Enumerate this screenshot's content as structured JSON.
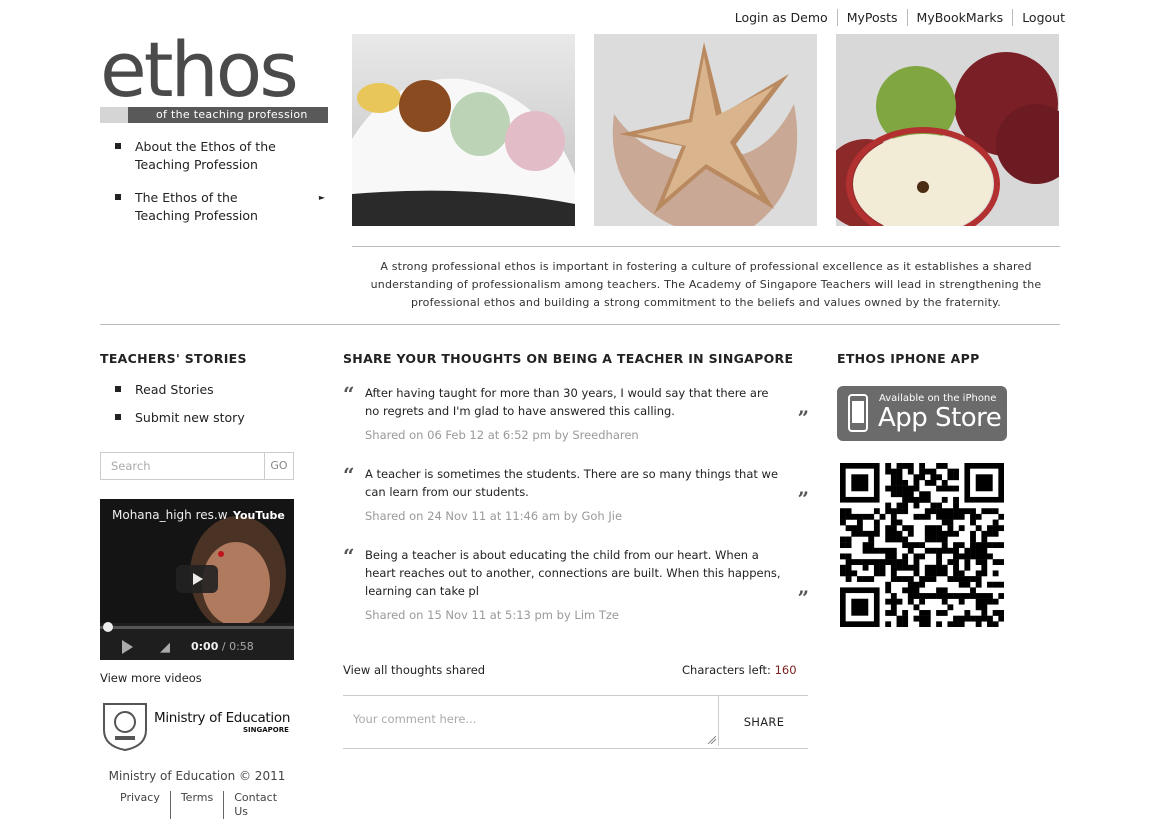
{
  "topnav": {
    "login": "Login as Demo",
    "myposts": "MyPosts",
    "mybookmarks": "MyBookMarks",
    "logout": "Logout"
  },
  "logo": {
    "word": "ethos",
    "tagline": "of the teaching profession"
  },
  "leftnav": {
    "items": [
      {
        "label": "About the Ethos of the Teaching Profession"
      },
      {
        "label": "The Ethos of the Teaching Profession"
      }
    ]
  },
  "intro": "A strong professional ethos is important in fostering a culture of professional excellence as it establishes a shared understanding of professionalism among teachers. The Academy of Singapore Teachers will lead in strengthening the professional ethos and building a strong commitment to the beliefs and values owned by the fraternity.",
  "stories": {
    "title": "TEACHERS' STORIES",
    "items": [
      "Read Stories",
      "Submit new story"
    ]
  },
  "search": {
    "placeholder": "Search",
    "go": "GO"
  },
  "video": {
    "title": "Mohana_high res.w",
    "brand": "YouTube",
    "time": "0:00",
    "duration": "/ 0:58",
    "progress": 0.0
  },
  "more_videos": "View more videos",
  "moe": {
    "name": "Ministry of Education",
    "sub": "SINGAPORE"
  },
  "footer": {
    "copyright": "Ministry of Education © 2011",
    "links": [
      "Privacy",
      "Terms",
      "Contact Us"
    ]
  },
  "share": {
    "title": "SHARE YOUR THOUGHTS ON BEING A TEACHER IN SINGAPORE",
    "thoughts": [
      {
        "text": "After having taught for more than 30 years, I would say that there are no regrets and I'm glad to have answered this calling.",
        "meta": "Shared on 06 Feb 12 at 6:52 pm by Sreedharen"
      },
      {
        "text": "A teacher is sometimes the students. There are so many things that we can learn from our students.",
        "meta": "Shared on 24 Nov 11 at 11:46 am by Goh Jie"
      },
      {
        "text": "Being a teacher is about educating the child from our heart. When a heart reaches out to another, connections are built. When this happens, learning can take pl",
        "meta": "Shared on 15 Nov 11 at 5:13 pm by Lim Tze"
      }
    ],
    "view_all": "View all thoughts shared",
    "chars_label": "Characters left:",
    "chars_value": "160",
    "comment_placeholder": "Your comment here...",
    "share_button": "SHARE"
  },
  "app": {
    "title": "ETHOS IPHONE APP",
    "badge_top": "Available on the iPhone",
    "badge_main": "App Store"
  },
  "colors": {
    "accent": "#5a5a5a",
    "link_number": "#7a1f1f"
  }
}
